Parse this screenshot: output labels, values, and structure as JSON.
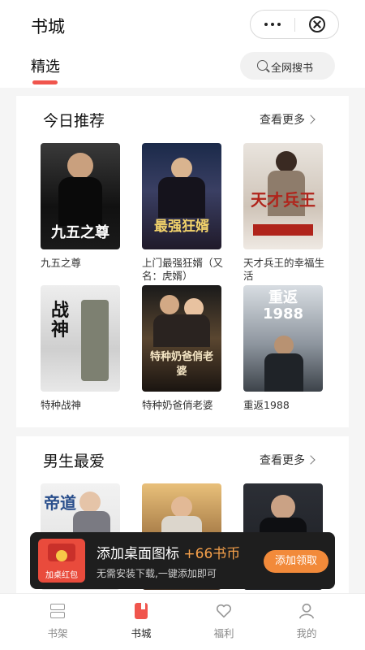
{
  "header": {
    "title": "书城"
  },
  "tabs": {
    "active": "精选",
    "search_placeholder": "全网搜书"
  },
  "sections": [
    {
      "title": "今日推荐",
      "more": "查看更多",
      "books": [
        {
          "name": "九五之尊",
          "cover_text": "九五之尊"
        },
        {
          "name": "上门最强狂婿（又名：虎婿）",
          "cover_text": "最强狂婿"
        },
        {
          "name": "天才兵王的幸福生活",
          "cover_text": "天才兵王"
        },
        {
          "name": "特种战神",
          "cover_text": "战神"
        },
        {
          "name": "特种奶爸俏老婆",
          "cover_text": "特种奶爸俏老婆"
        },
        {
          "name": "重返1988",
          "cover_text": "重返1988"
        }
      ]
    },
    {
      "title": "男生最爱",
      "more": "查看更多",
      "books": [
        {
          "name": "",
          "cover_text": "帝道"
        },
        {
          "name": "",
          "cover_text": ""
        },
        {
          "name": "",
          "cover_text": ""
        }
      ]
    }
  ],
  "banner": {
    "envelope_label": "加桌红包",
    "title": "添加桌面图标",
    "reward": "+66书币",
    "subtitle": "无需安装下载,一键添加即可",
    "button": "添加领取"
  },
  "bottom_nav": [
    {
      "label": "书架",
      "icon": "bookshelf-icon"
    },
    {
      "label": "书城",
      "icon": "bookstore-icon",
      "active": true
    },
    {
      "label": "福利",
      "icon": "heart-icon"
    },
    {
      "label": "我的",
      "icon": "user-icon"
    }
  ],
  "colors": {
    "accent": "#f0554d",
    "banner_bg": "#1e1e1e",
    "cta": "#f28a3a",
    "reward": "#f5a04a"
  }
}
